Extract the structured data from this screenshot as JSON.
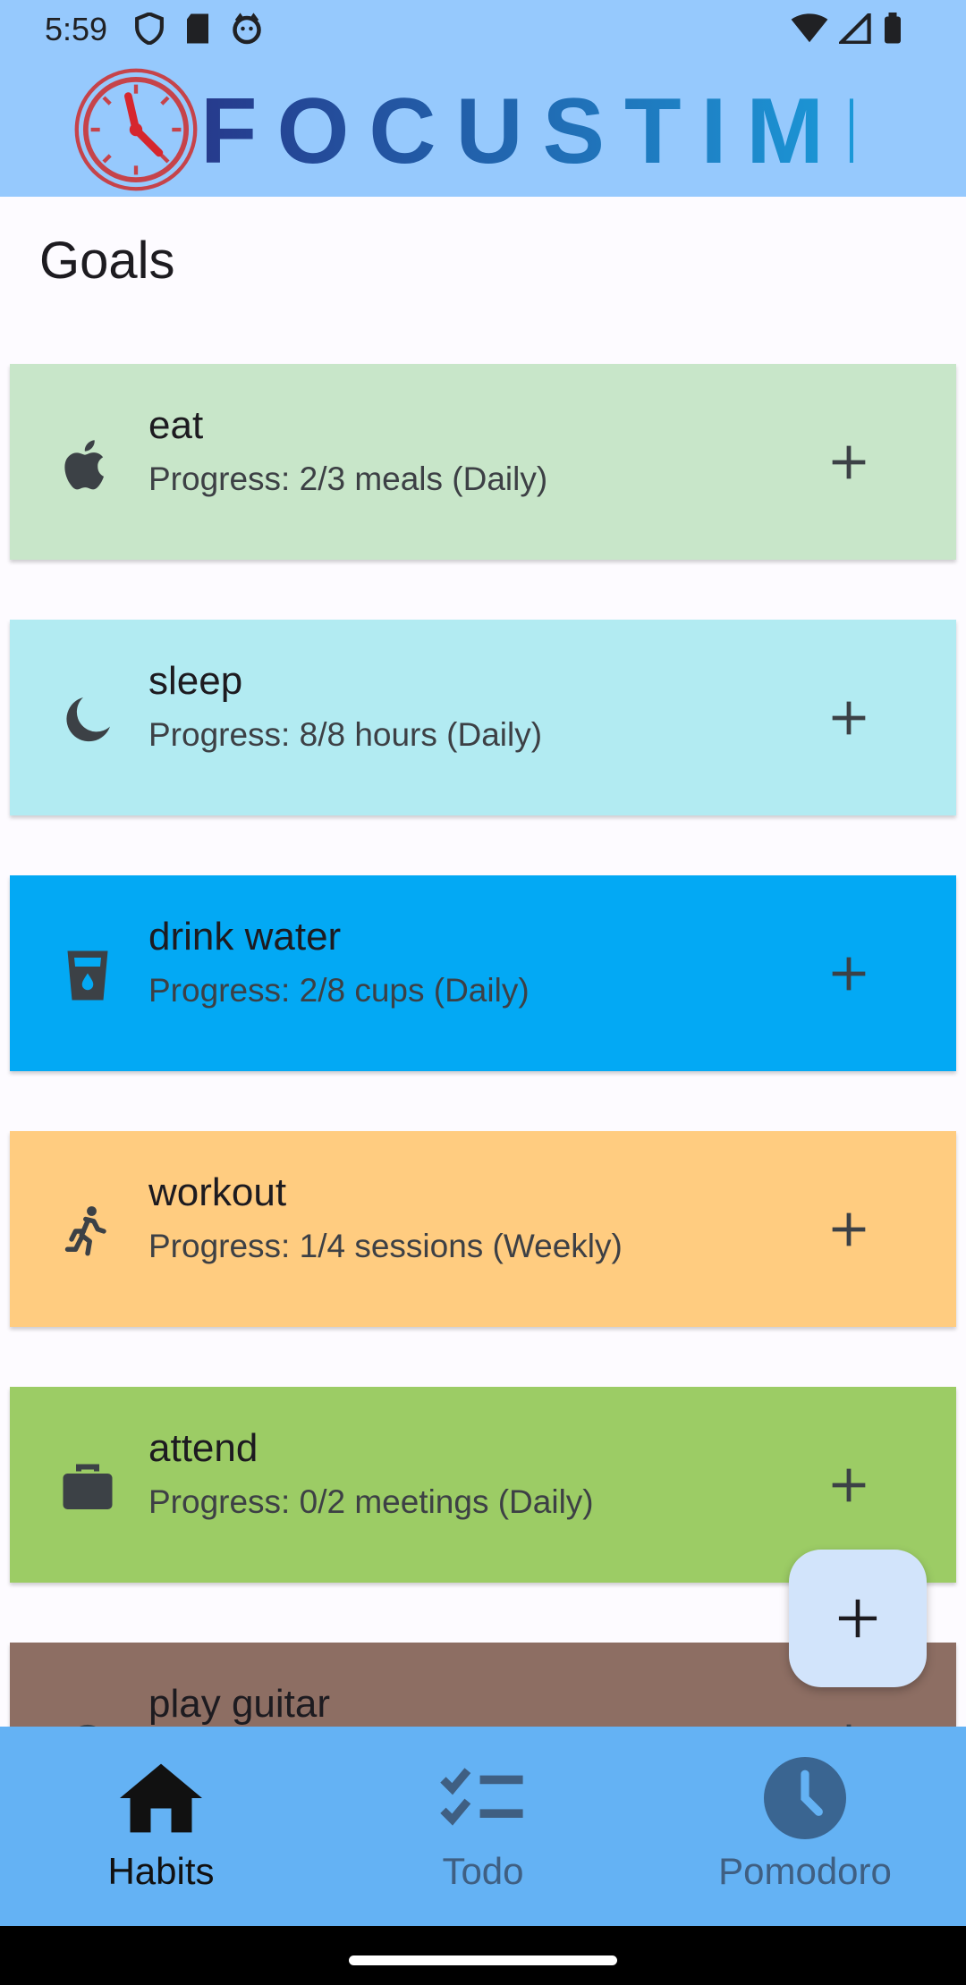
{
  "status_bar": {
    "time": "5:59"
  },
  "app": {
    "logo_text": "FOCUSTIME",
    "page_title": "Goals"
  },
  "habits": [
    {
      "name": "eat",
      "progress": "Progress: 2/3 meals (Daily)",
      "icon": "apple-icon",
      "color": "#c8e6c9"
    },
    {
      "name": "sleep",
      "progress": "Progress: 8/8 hours (Daily)",
      "icon": "moon-icon",
      "color": "#b2ebf2"
    },
    {
      "name": "drink water",
      "progress": "Progress: 2/8 cups (Daily)",
      "icon": "water-glass-icon",
      "color": "#03a9f4"
    },
    {
      "name": "workout",
      "progress": "Progress: 1/4 sessions (Weekly)",
      "icon": "running-icon",
      "color": "#ffcc80"
    },
    {
      "name": "attend",
      "progress": "Progress: 0/2 meetings (Daily)",
      "icon": "briefcase-icon",
      "color": "#9ccc65"
    },
    {
      "name": "play guitar",
      "progress": "",
      "icon": "circle-icon",
      "color": "#8d6e63"
    }
  ],
  "nav": {
    "habits": "Habits",
    "todo": "Todo",
    "pomodoro": "Pomodoro"
  },
  "colors": {
    "header_bg": "#96c9fd",
    "nav_bg": "#64b2f4",
    "fab_bg": "#d2e4fb"
  }
}
